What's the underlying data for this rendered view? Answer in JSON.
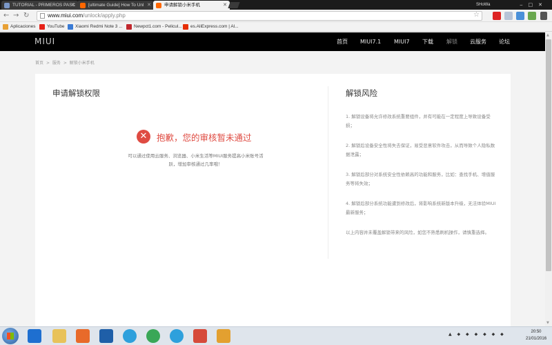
{
  "browser": {
    "tabs": [
      {
        "title": "TUTORIAL - PRIMEROS PASC",
        "favicon_color": "#7b98c8",
        "active": false
      },
      {
        "title": "[ultimate Guide] How To Unl",
        "favicon_color": "#ff6700",
        "active": false
      },
      {
        "title": "申请解锁小米手机",
        "favicon_color": "#ff6700",
        "active": true
      }
    ],
    "user": "SHoWa",
    "url_host": "www.miui.com",
    "url_path": "/unlock/apply.php",
    "bookmarks": [
      {
        "label": "Aplicaciones",
        "color": "#e8a135"
      },
      {
        "label": "YouTube",
        "color": "#e62117"
      },
      {
        "label": "Xiaomi Redmi Note 3 ...",
        "color": "#3a7bd5"
      },
      {
        "label": "Newpct1.com - Pelicul...",
        "color": "#c1272d"
      },
      {
        "label": "es.AliExpress.com | Al...",
        "color": "#e62e04"
      }
    ]
  },
  "site": {
    "logo": "MIUI",
    "nav": [
      {
        "label": "首页",
        "dim": false
      },
      {
        "label": "MIUI7.1",
        "dim": false
      },
      {
        "label": "MIUI7",
        "dim": false
      },
      {
        "label": "下载",
        "dim": false
      },
      {
        "label": "解锁",
        "dim": true
      },
      {
        "label": "云服务",
        "dim": false
      },
      {
        "label": "论坛",
        "dim": false
      }
    ],
    "breadcrumb": [
      "首页",
      ">",
      "服务",
      ">",
      "解锁小米手机"
    ],
    "left_title": "申请解锁权限",
    "error_icon": "✕",
    "error_message": "抱歉，您的审核暂未通过",
    "error_description": "可以通过使用云服务、浏览器、小米生活等MIUI服务提高小米账号活跃，增加审核通过几率哦！",
    "right_title": "解锁风险",
    "risks": [
      "1. 解锁设备将允许修改系统重要组件，并有可能在一定程度上导致设备受损；",
      "2. 解锁后设备安全性将失去保证，易受恶意软件攻击，从而导致个人隐私数据泄露；",
      "3. 解锁后部分对系统安全性依赖高的功能和服务，比如：查找手机、增值服务等将失效；",
      "4. 解锁后部分系统功能遭到修改后，将影响系统新版本升级，无法体验MIUI最新服务；",
      "以上内容并未覆盖解锁带来的风险，如您不熟悉刷机操作，请慎重选择。"
    ],
    "accent_color": "#df4b42"
  },
  "taskbar": {
    "time": "20:50",
    "date": "21/01/2016",
    "apps": [
      {
        "name": "ie-icon",
        "color": "#1e6fd0"
      },
      {
        "name": "file-explorer-icon",
        "color": "#e8c25a"
      },
      {
        "name": "media-player-icon",
        "color": "#e86a2a"
      },
      {
        "name": "outlook-icon",
        "color": "#1f5fa8"
      },
      {
        "name": "telegram-icon",
        "color": "#2ea0dc"
      },
      {
        "name": "chrome-icon",
        "color": "#3aa757"
      },
      {
        "name": "telegram-icon",
        "color": "#2ea0dc"
      },
      {
        "name": "mail-icon",
        "color": "#d64a3a"
      },
      {
        "name": "app-icon",
        "color": "#e3a030"
      }
    ]
  }
}
